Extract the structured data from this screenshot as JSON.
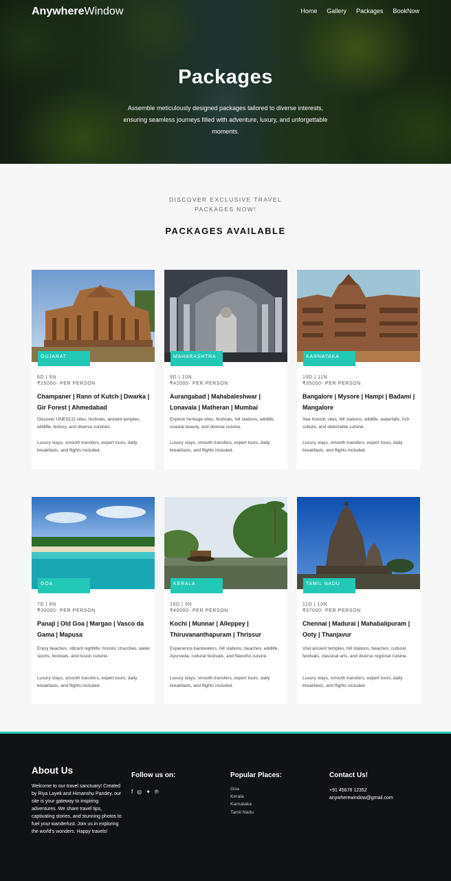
{
  "brand": {
    "bold": "Anywhere",
    "regular": "Window"
  },
  "nav": [
    "Home",
    "Gallery",
    "Packages",
    "BookNow"
  ],
  "hero": {
    "title": "Packages",
    "subtitle": "Assemble meticulously designed packages tailored to diverse interests, ensuring seamless journeys filled with adventure, luxury, and unforgettable moments."
  },
  "section": {
    "discover": "DISCOVER EXCLUSIVE TRAVEL PACKAGES NOW!",
    "heading": "PACKAGES AVAILABLE"
  },
  "cards": [
    {
      "tag": "GUJARAT",
      "duration": "6D | 5N",
      "price": "₹25000- PER PERSON",
      "places": "Champaner | Rann of Kutch | Dwarka | Gir Forest | Ahmedabad",
      "desc": "Discover UNESCO sites, festivals, ancient temples, wildlife, history, and diverse cuisines.",
      "incl": "Luxury stays, smooth transfers, expert tours, daily breakfasts, and flights included."
    },
    {
      "tag": "MAHARASHTRA",
      "duration": "9D | 10N",
      "price": "₹42000- PER PERSON",
      "places": "Aurangabad | Mahabaleshwar | Lonavala | Matheran | Mumbai",
      "desc": "Explore heritage sites, festivals, hill stations, wildlife, coastal beauty, and diverse cuisine.",
      "incl": "Luxury stays, smooth transfers, expert tours, daily breakfasts, and flights included."
    },
    {
      "tag": "KARNATAKA",
      "duration": "10D | 11N",
      "price": "₹35000- PER PERSON",
      "places": "Bangalore | Mysore | Hampi | Badami | Mangalore",
      "desc": "See historic sites, hill stations, wildlife, waterfalls, rich culture, and delectable cuisine.",
      "incl": "Luxury stays, smooth transfers, expert tours, daily breakfasts, and flights included."
    },
    {
      "tag": "GOA",
      "duration": "7D | 6N",
      "price": "₹30000- PER PERSON",
      "places": "Panaji | Old Goa | Margao | Vasco da Gama | Mapusa",
      "desc": "Enjoy beaches, vibrant nightlife, historic churches, water sports, festivals, and fusion cuisine.",
      "incl": "Luxury stays, smooth transfers, expert tours, daily breakfasts, and flights included."
    },
    {
      "tag": "KERALA",
      "duration": "10D | 9N",
      "price": "₹40000- PER PERSON",
      "places": "Kochi | Munnar | Alleppey | Thiruvananthapuram | Thrissur",
      "desc": "Experience backwaters, hill stations, beaches, wildlife, Ayurveda, cultural festivals, and flavorful cuisine.",
      "incl": "Luxury stays, smooth transfers, expert tours, daily breakfasts, and flights included."
    },
    {
      "tag": "TAMIL NADU",
      "duration": "11D | 10N",
      "price": "₹37000- PER PERSON",
      "places": "Chennai | Madurai | Mahabalipuram | Ooty | Thanjavur",
      "desc": "Visit ancient temples, hill stations, beaches, cultural festivals, classical arts, and diverse regional cuisine.",
      "incl": "Luxury stays, smooth transfers, expert tours, daily breakfasts, and flights included."
    }
  ],
  "footer": {
    "about_heading": "About Us",
    "about_text": "Welcome to our travel sanctuary! Created by Riya Layek and Himanshu Pandey, our site is your gateway to inspiring adventures. We share travel tips, captivating stories, and stunning photos to fuel your wanderlust. Join us in exploring the world's wonders. Happy travels!",
    "follow_heading": "Follow us on:",
    "social_icons": [
      "facebook-icon",
      "instagram-icon",
      "twitter-icon",
      "pinterest-icon"
    ],
    "popular_heading": "Popular Places:",
    "popular": [
      "Goa",
      "Kerala",
      "Karnataka",
      "Tamil Nadu"
    ],
    "contact_heading": "Contact Us!",
    "phone": "+91 45678 12352",
    "email": "anywherewindow@gmail.com"
  }
}
